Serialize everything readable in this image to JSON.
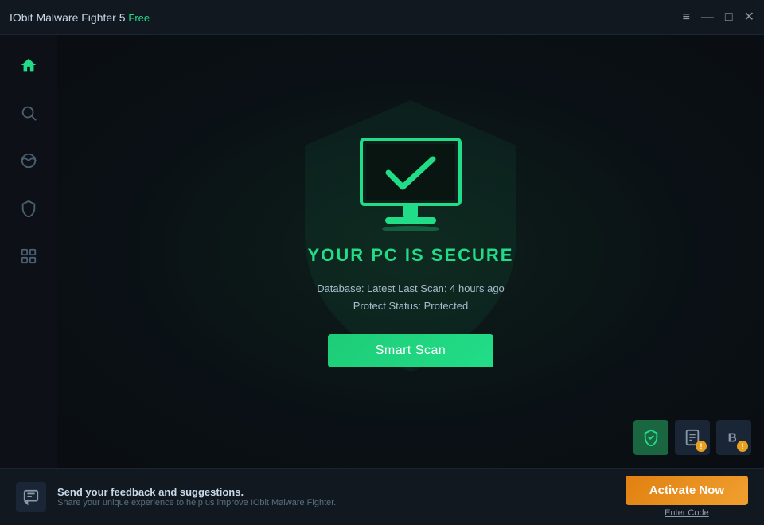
{
  "titlebar": {
    "app_name": "IObit Malware Fighter 5",
    "badge": "Free",
    "controls": {
      "menu": "≡",
      "minimize": "—",
      "maximize": "□",
      "close": "✕"
    }
  },
  "sidebar": {
    "items": [
      {
        "id": "home",
        "icon": "⌂",
        "label": "Home",
        "active": true
      },
      {
        "id": "scan",
        "icon": "⌕",
        "label": "Scan",
        "active": false
      },
      {
        "id": "protection",
        "icon": "🌐",
        "label": "Protection",
        "active": false
      },
      {
        "id": "shield",
        "icon": "⛨",
        "label": "Shield",
        "active": false
      },
      {
        "id": "tools",
        "icon": "⊞",
        "label": "Tools",
        "active": false
      }
    ]
  },
  "main": {
    "status_title": "YOUR PC IS SECURE",
    "database_label": "Database:",
    "database_value": "Latest",
    "last_scan_label": "Last Scan:",
    "last_scan_value": "4 hours ago",
    "protect_status_label": "Protect Status:",
    "protect_status_value": "Protected",
    "detail_line1": "Database: Latest          Last Scan: 4 hours ago",
    "detail_line2": "Protect Status: Protected",
    "scan_button": "Smart Scan"
  },
  "action_icons": {
    "shield_badge": "!",
    "doc_badge": "!"
  },
  "footer": {
    "feedback_title": "Send your feedback and suggestions.",
    "feedback_subtitle": "Share your unique experience to help us improve IObit Malware Fighter.",
    "activate_button": "Activate Now",
    "enter_code": "Enter Code"
  },
  "colors": {
    "green": "#22dd88",
    "orange": "#f0a030",
    "dark_bg": "#0d1117",
    "sidebar_bg": "#0d1117",
    "header_bg": "#111820"
  }
}
